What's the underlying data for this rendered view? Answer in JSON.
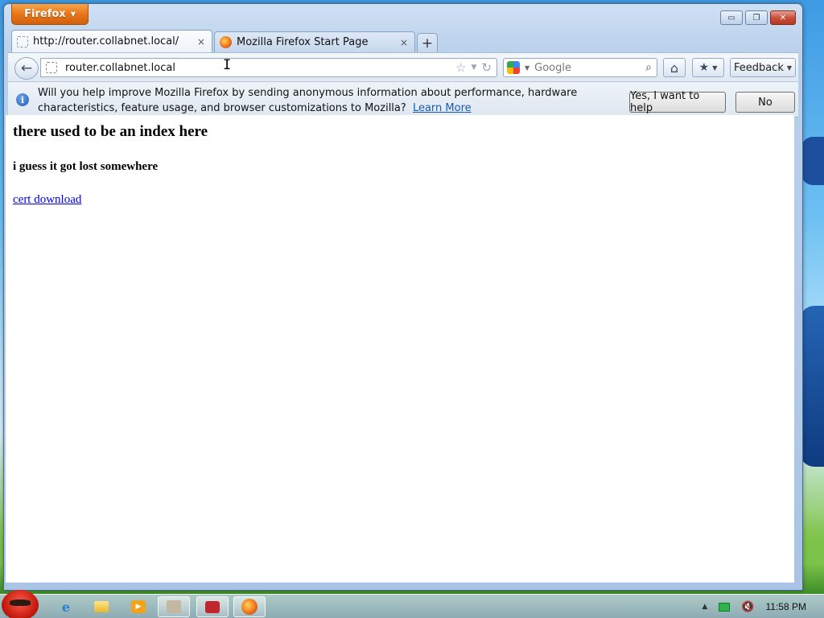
{
  "window": {
    "app_button": "Firefox",
    "controls": {
      "minimize": "▭",
      "maximize": "❐",
      "close": "✕"
    }
  },
  "tabs": [
    {
      "label": "http://router.collabnet.local/",
      "close": "×"
    },
    {
      "label": "Mozilla Firefox Start Page",
      "close": "×"
    }
  ],
  "new_tab": "+",
  "nav": {
    "back": "←",
    "url": "router.collabnet.local",
    "star": "☆",
    "dropdown": "▼",
    "reload": "↻",
    "search_placeholder": "Google",
    "search_icon": "🔍",
    "home": "⌂",
    "bookmarks": "★",
    "feedback": "Feedback"
  },
  "notification": {
    "message": "Will you help improve Mozilla Firefox by sending anonymous information about performance, hardware characteristics, feature usage, and browser customizations to Mozilla?",
    "learn_more": "Learn More",
    "yes_button": "Yes, I want to help",
    "no_button": "No"
  },
  "page": {
    "heading": "there used to be an index here",
    "subheading": "i guess it got lost somewhere",
    "link": "cert download"
  },
  "taskbar": {
    "ie_glyph": "e",
    "media_glyph": "▶",
    "tray_arrow": "▲",
    "volume_glyph": "🔇",
    "clock": "11:58 PM"
  },
  "colors": {
    "firefox_orange": "#e8761a",
    "link_blue": "#0000ee",
    "learn_more_blue": "#1a5cb0"
  }
}
